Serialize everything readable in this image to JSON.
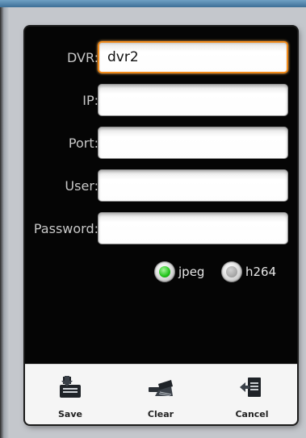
{
  "form": {
    "fields": [
      {
        "label": "DVR:",
        "value": "dvr2"
      },
      {
        "label": "IP:",
        "value": ""
      },
      {
        "label": "Port:",
        "value": ""
      },
      {
        "label": "User:",
        "value": ""
      },
      {
        "label": "Password:",
        "value": ""
      }
    ],
    "codec": {
      "options": [
        {
          "label": "jpeg",
          "selected": true
        },
        {
          "label": "h264",
          "selected": false
        }
      ]
    }
  },
  "toolbar": {
    "save_label": "Save",
    "save_icon": "save-icon",
    "clear_label": "Clear",
    "clear_icon": "clear-broom-icon",
    "cancel_label": "Cancel",
    "cancel_icon": "cancel-exit-icon"
  },
  "colors": {
    "dialog_background": "#050505",
    "focus_border": "#f08a1a",
    "radio_selected": "#21c41a"
  }
}
